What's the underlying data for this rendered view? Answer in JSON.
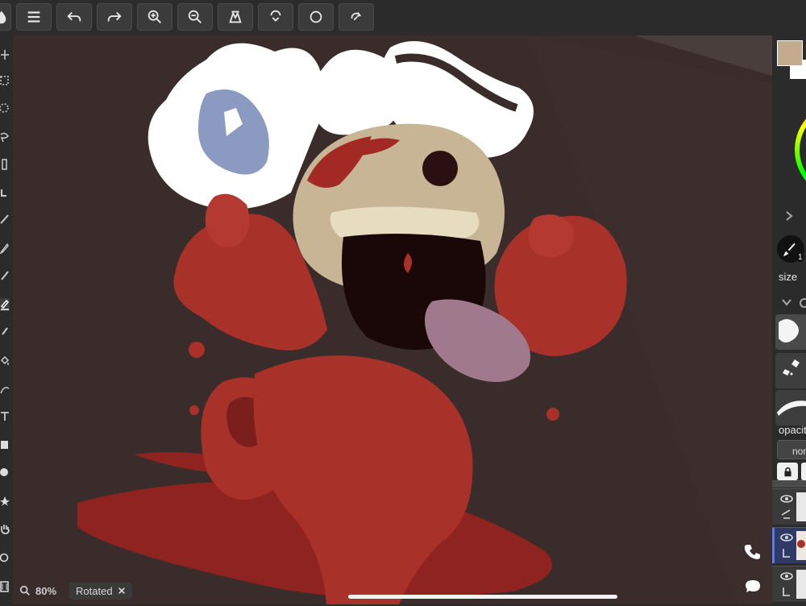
{
  "toolbar": {
    "buttons": [
      {
        "name": "app-menu-button",
        "icon": "droplet-icon"
      },
      {
        "name": "menu-button",
        "icon": "hamburger-icon"
      },
      {
        "name": "undo-button",
        "icon": "undo-icon"
      },
      {
        "name": "redo-button",
        "icon": "redo-icon"
      },
      {
        "name": "zoom-in-button",
        "icon": "zoom-in-icon"
      },
      {
        "name": "zoom-out-button",
        "icon": "zoom-out-icon"
      },
      {
        "name": "reference-button",
        "icon": "reference-icon"
      },
      {
        "name": "stabilizer-button",
        "icon": "stabilizer-icon"
      },
      {
        "name": "lasso-button",
        "icon": "circle-icon"
      },
      {
        "name": "symmetry-button",
        "icon": "symmetry-icon"
      }
    ]
  },
  "right_panel": {
    "primary_color": "#c5ab8d",
    "secondary_color": "#ffffff",
    "brush_size_badge": "1",
    "size_label": "size",
    "opacity_label": "opacit",
    "blend_mode": "nor"
  },
  "status": {
    "zoom": "80%",
    "rotation_label": "Rotated"
  }
}
